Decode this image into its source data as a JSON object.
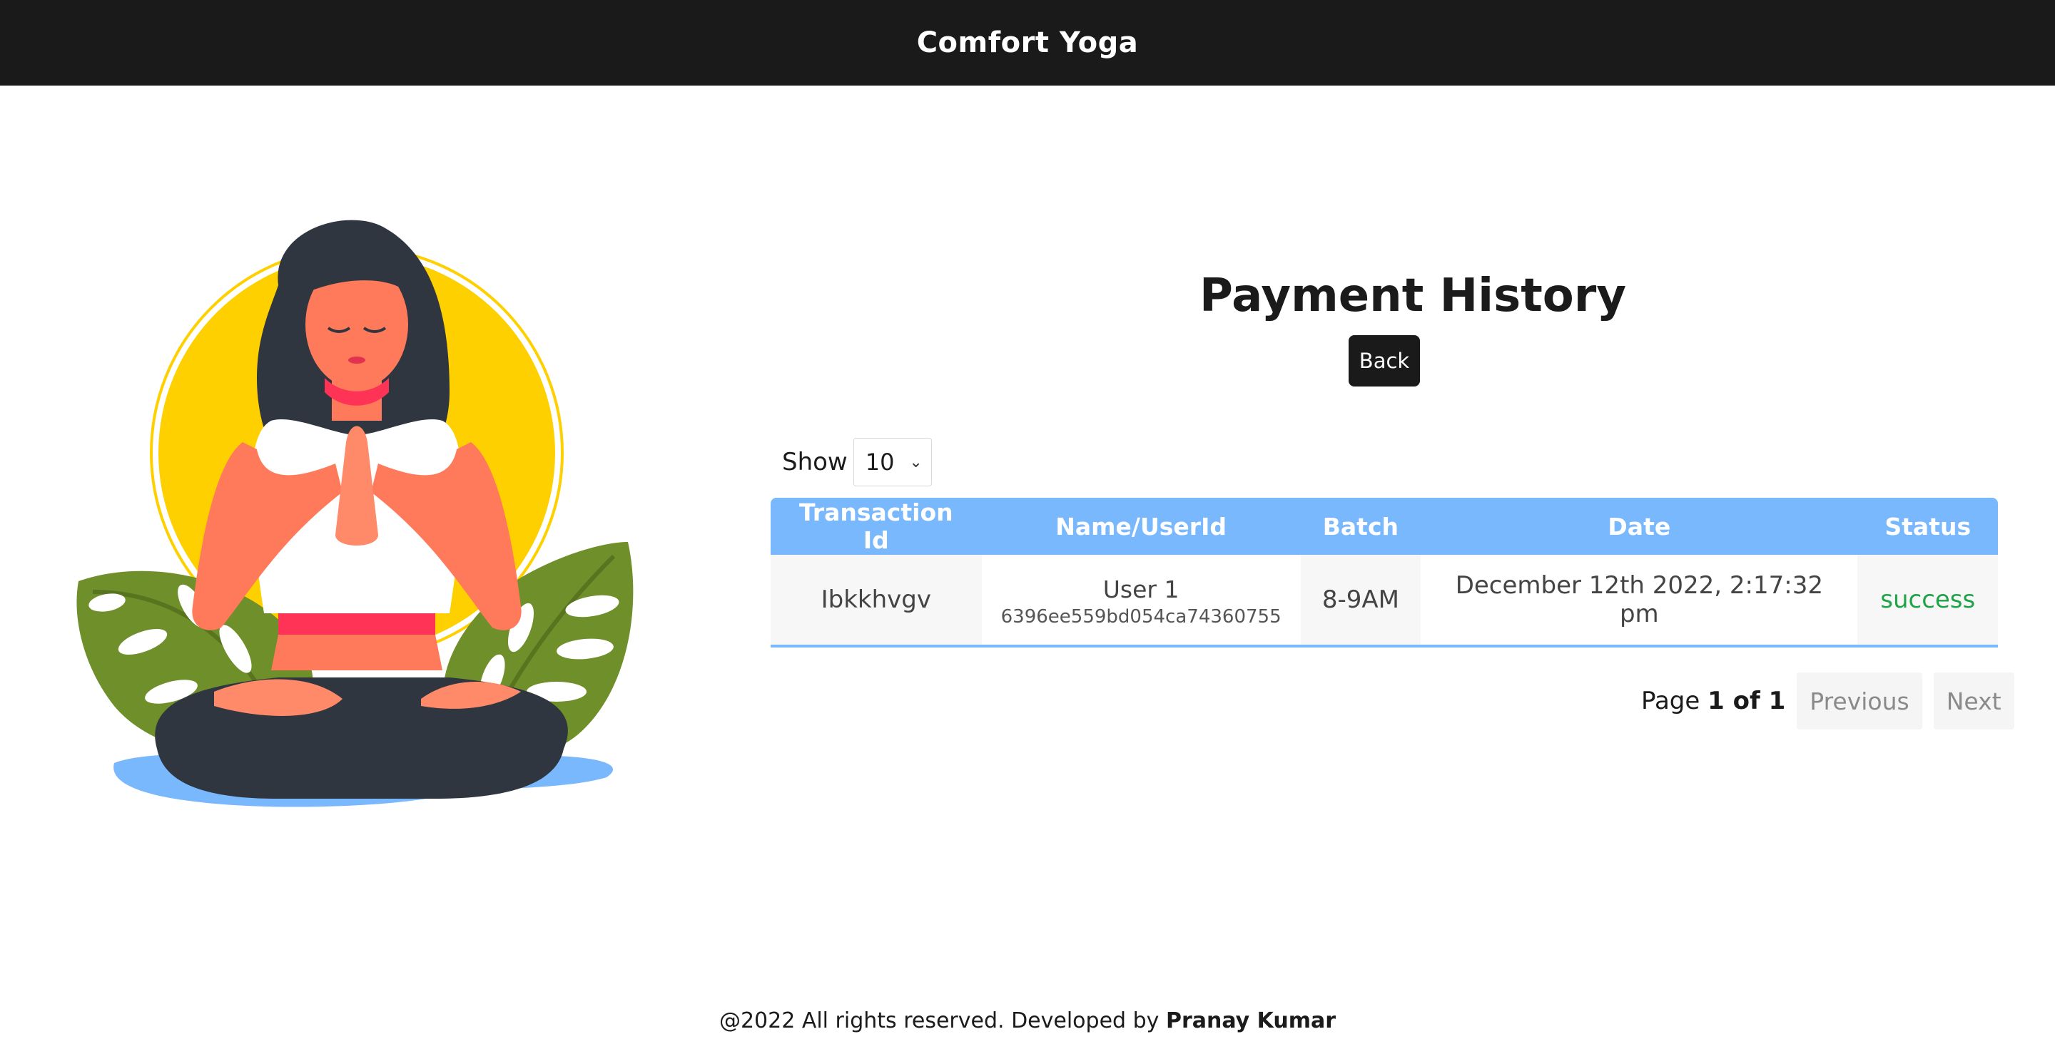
{
  "header": {
    "brand": "Comfort Yoga"
  },
  "main": {
    "title": "Payment History",
    "back_label": "Back",
    "show_label": "Show",
    "page_size": "10",
    "table": {
      "columns": [
        "Transaction Id",
        "Name/UserId",
        "Batch",
        "Date",
        "Status"
      ],
      "rows": [
        {
          "transaction_id": "Ibkkhvgv",
          "name": "User 1",
          "user_id": "6396ee559bd054ca74360755",
          "batch": "8-9AM",
          "date": "December 12th 2022, 2:17:32 pm",
          "status": "success"
        }
      ]
    },
    "pagination": {
      "page_word": "Page",
      "page_info": "1 of 1",
      "previous_label": "Previous",
      "next_label": "Next"
    }
  },
  "footer": {
    "text": "@2022 All rights reserved. Developed by",
    "author": "Pranay Kumar"
  },
  "colors": {
    "header_bg": "#1a1a1a",
    "table_header_bg": "#79b8fc",
    "status_success": "#1fa347",
    "sun": "#ffd000",
    "leaf": "#6f8f2a",
    "water": "#79b8fc"
  }
}
